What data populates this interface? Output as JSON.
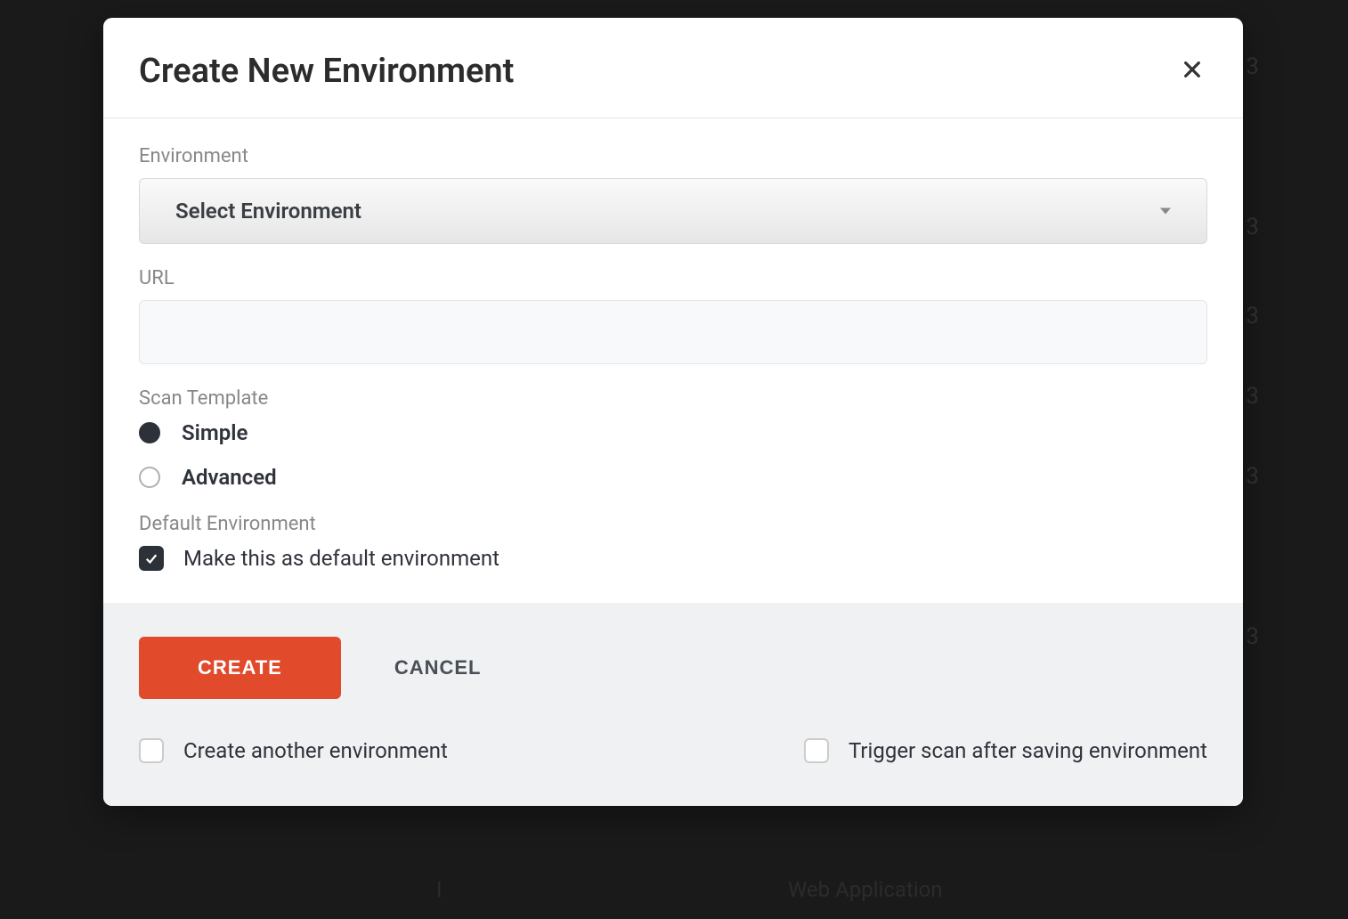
{
  "modal": {
    "title": "Create New Environment",
    "fields": {
      "environment": {
        "label": "Environment",
        "selected": "Select Environment"
      },
      "url": {
        "label": "URL",
        "value": ""
      },
      "scan_template": {
        "label": "Scan Template",
        "options": {
          "simple": "Simple",
          "advanced": "Advanced"
        },
        "selected": "simple"
      },
      "default_env": {
        "label": "Default Environment",
        "checkbox_label": "Make this as default environment",
        "checked": true
      }
    },
    "footer": {
      "create_label": "CREATE",
      "cancel_label": "CANCEL",
      "create_another_label": "Create another environment",
      "create_another_checked": false,
      "trigger_scan_label": "Trigger scan after saving environment",
      "trigger_scan_checked": false
    }
  },
  "background": {
    "right_digits": "3",
    "bottom_text_left": "I",
    "bottom_text_right": "Web Application"
  }
}
